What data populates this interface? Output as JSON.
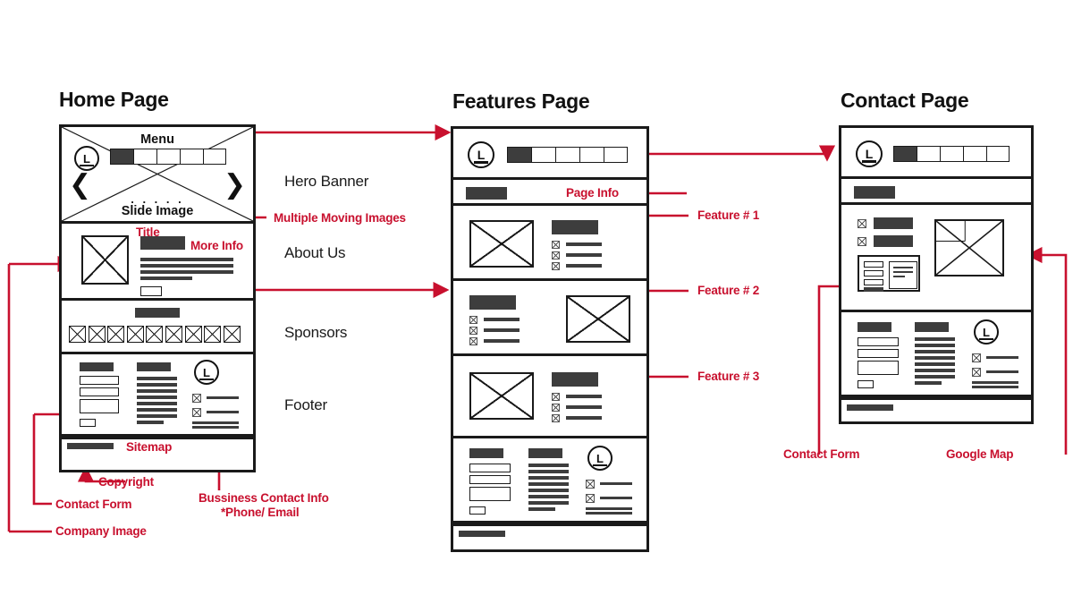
{
  "diagram": {
    "title_home": "Home Page",
    "title_features": "Features Page",
    "title_contact": "Contact Page",
    "accent_color": "#C8102E",
    "ink_color": "#1a1a1a",
    "fill_color": "#3d3d3d"
  },
  "home": {
    "hero": {
      "menu_label": "Menu",
      "slide_label": "Slide Image",
      "dots": ". . . . .",
      "prev_icon": "❮",
      "next_icon": "❯",
      "logo_letter": "L",
      "nav_cell_count": 5,
      "nav_active_index": 0
    },
    "sections": [
      {
        "name": "Hero Banner",
        "label": "Hero Banner"
      },
      {
        "name": "About Us",
        "label": "About Us"
      },
      {
        "name": "Sponsors",
        "label": "Sponsors"
      },
      {
        "name": "Footer",
        "label": "Footer"
      }
    ],
    "sponsors": {
      "logo_count": 9
    },
    "annotations": [
      {
        "id": "multiple-moving-images",
        "text": "Multiple Moving Images"
      },
      {
        "id": "title",
        "text": "Title"
      },
      {
        "id": "more-info",
        "text": "More Info"
      },
      {
        "id": "sitemap",
        "text": "Sitemap"
      },
      {
        "id": "copyright",
        "text": "Copyright"
      },
      {
        "id": "contact-form",
        "text": "Contact Form"
      },
      {
        "id": "company-image",
        "text": "Company Image"
      },
      {
        "id": "business-contact-line1",
        "text": "Bussiness Contact Info"
      },
      {
        "id": "business-contact-line2",
        "text": "*Phone/ Email"
      }
    ]
  },
  "features": {
    "logo_letter": "L",
    "nav_cell_count": 5,
    "nav_active_index": 0,
    "annotations": [
      {
        "id": "page-info",
        "text": "Page Info"
      },
      {
        "id": "feature-1",
        "text": "Feature # 1"
      },
      {
        "id": "feature-2",
        "text": "Feature # 2"
      },
      {
        "id": "feature-3",
        "text": "Feature # 3"
      }
    ],
    "feature_blocks": [
      {
        "name": "feature-1",
        "image_side": "left",
        "bullet_count": 3
      },
      {
        "name": "feature-2",
        "image_side": "right",
        "bullet_count": 3
      },
      {
        "name": "feature-3",
        "image_side": "left",
        "bullet_count": 3
      }
    ]
  },
  "contact": {
    "logo_letter": "L",
    "nav_cell_count": 5,
    "nav_active_index": 0,
    "annotations": [
      {
        "id": "contact-form",
        "text": "Contact Form"
      },
      {
        "id": "google-map",
        "text": "Google Map"
      }
    ]
  },
  "footer_common": {
    "form_field_count": 3,
    "sitemap_line_count": 8,
    "logo_letter": "L",
    "contact_line_count": 2
  }
}
